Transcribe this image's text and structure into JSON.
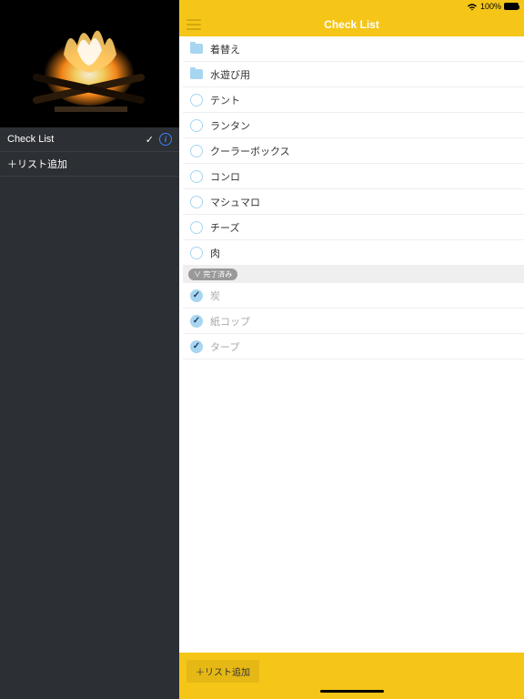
{
  "statusbar": {
    "battery_text": "100%"
  },
  "sidebar": {
    "title": "Check List",
    "add_label": "＋リスト追加"
  },
  "header": {
    "title": "Check List"
  },
  "folders": [
    {
      "label": "着替え"
    },
    {
      "label": "水遊び用"
    }
  ],
  "unchecked": [
    {
      "label": "テント"
    },
    {
      "label": "ランタン"
    },
    {
      "label": "クーラーボックス"
    },
    {
      "label": "コンロ"
    },
    {
      "label": "マシュマロ"
    },
    {
      "label": "チーズ"
    },
    {
      "label": "肉"
    }
  ],
  "completed_section": "∨ 完了済み",
  "checked": [
    {
      "label": "炭"
    },
    {
      "label": "紙コップ"
    },
    {
      "label": "タープ"
    }
  ],
  "bottom": {
    "add_label": "＋リスト追加"
  }
}
